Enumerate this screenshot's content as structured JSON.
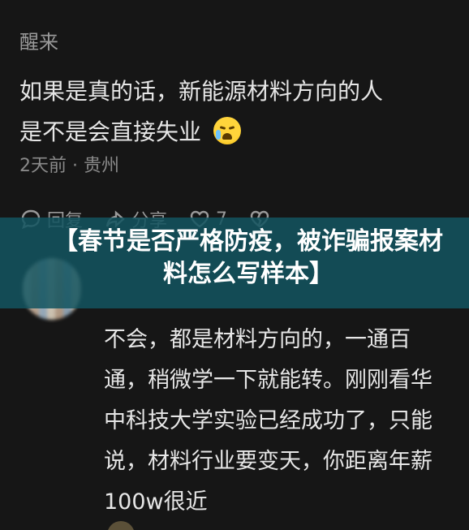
{
  "comment": {
    "username": "醒来",
    "line1": "如果是真的话，新能源材料方向的人",
    "line2": "是不是会直接失业",
    "emoji": "crying-face-icon",
    "meta": "2天前 · 贵州"
  },
  "actions": {
    "reply": "回复",
    "share": "分享",
    "like_count": "7"
  },
  "banner": {
    "title": "【春节是否严格防疫，被诈骗报案材料怎么写样本】"
  },
  "reply": {
    "text": "不会，都是材料方向的，一通百通，稍微学一下就能转。刚刚看华中科技大学实验已经成功了，只能说，材料行业要变天，你距离年薪100w很近"
  },
  "colors": {
    "background": "#161616",
    "banner": "#135460",
    "text": "#e6e6e6",
    "muted": "#8a8a8a"
  }
}
